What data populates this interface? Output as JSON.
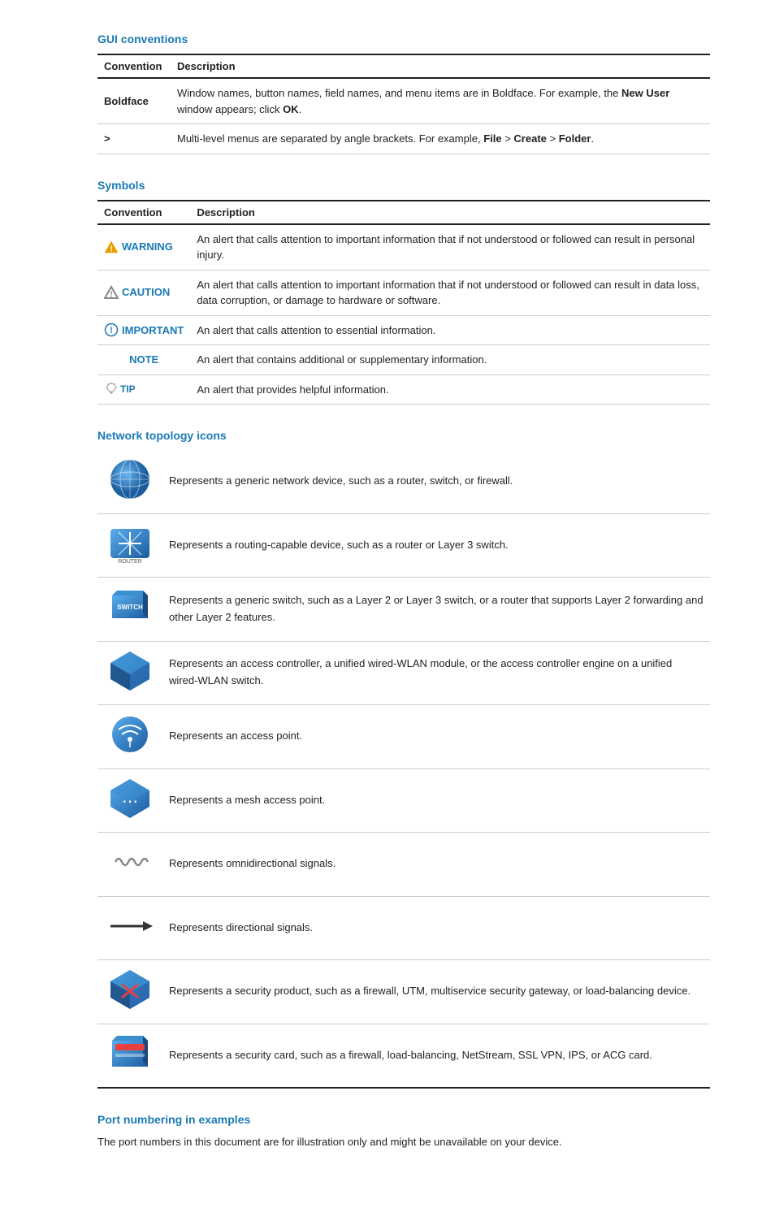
{
  "gui_conventions": {
    "title": "GUI conventions",
    "table": {
      "col1": "Convention",
      "col2": "Description",
      "rows": [
        {
          "convention": "Boldface",
          "description_parts": [
            {
              "text": "Window names, button names, field names, and menu items are in Boldface. For example, the "
            },
            {
              "bold": "New User"
            },
            {
              "text": " window appears; click "
            },
            {
              "bold": "OK"
            },
            {
              "text": "."
            }
          ]
        },
        {
          "convention": ">",
          "description_parts": [
            {
              "text": "Multi-level menus are separated by angle brackets. For example, "
            },
            {
              "bold": "File"
            },
            {
              "text": " > "
            },
            {
              "bold": "Create"
            },
            {
              "text": " > "
            },
            {
              "bold": "Folder"
            },
            {
              "text": "."
            }
          ]
        }
      ]
    }
  },
  "symbols": {
    "title": "Symbols",
    "table": {
      "col1": "Convention",
      "col2": "Description",
      "rows": [
        {
          "type": "warning",
          "label": "WARNING",
          "description": "An alert that calls attention to important information that if not understood or followed can result in personal injury."
        },
        {
          "type": "caution",
          "label": "CAUTION",
          "description": "An alert that calls attention to important information that if not understood or followed can result in data loss, data corruption, or damage to hardware or software."
        },
        {
          "type": "important",
          "label": "IMPORTANT",
          "description": "An alert that calls attention to essential information."
        },
        {
          "type": "note",
          "label": "NOTE",
          "description": "An alert that contains additional or supplementary information."
        },
        {
          "type": "tip",
          "label": "TIP",
          "description": "An alert that provides helpful information."
        }
      ]
    }
  },
  "network_topology": {
    "title": "Network topology icons",
    "rows": [
      {
        "icon_type": "generic",
        "description": "Represents a generic network device, such as a router, switch, or firewall."
      },
      {
        "icon_type": "router",
        "description": "Represents a routing-capable device, such as a router or Layer 3 switch."
      },
      {
        "icon_type": "switch",
        "description": "Represents a generic switch, such as a Layer 2 or Layer 3 switch, or a router that supports Layer 2 forwarding and other Layer 2 features."
      },
      {
        "icon_type": "access_controller",
        "description": "Represents an access controller, a unified wired-WLAN module, or the access controller engine on a unified wired-WLAN switch."
      },
      {
        "icon_type": "access_point",
        "description": "Represents an access point."
      },
      {
        "icon_type": "mesh_ap",
        "description": "Represents a mesh access point."
      },
      {
        "icon_type": "omni_signal",
        "description": "Represents omnidirectional signals."
      },
      {
        "icon_type": "directional_signal",
        "description": "Represents directional signals."
      },
      {
        "icon_type": "security_product",
        "description": "Represents a security product, such as a firewall, UTM, multiservice security gateway, or load-balancing device."
      },
      {
        "icon_type": "security_card",
        "description": "Represents a security card, such as a firewall, load-balancing, NetStream, SSL VPN, IPS, or ACG card."
      }
    ]
  },
  "port_numbering": {
    "title": "Port numbering in examples",
    "description": "The port numbers in this document are for illustration only and might be unavailable on your device."
  }
}
